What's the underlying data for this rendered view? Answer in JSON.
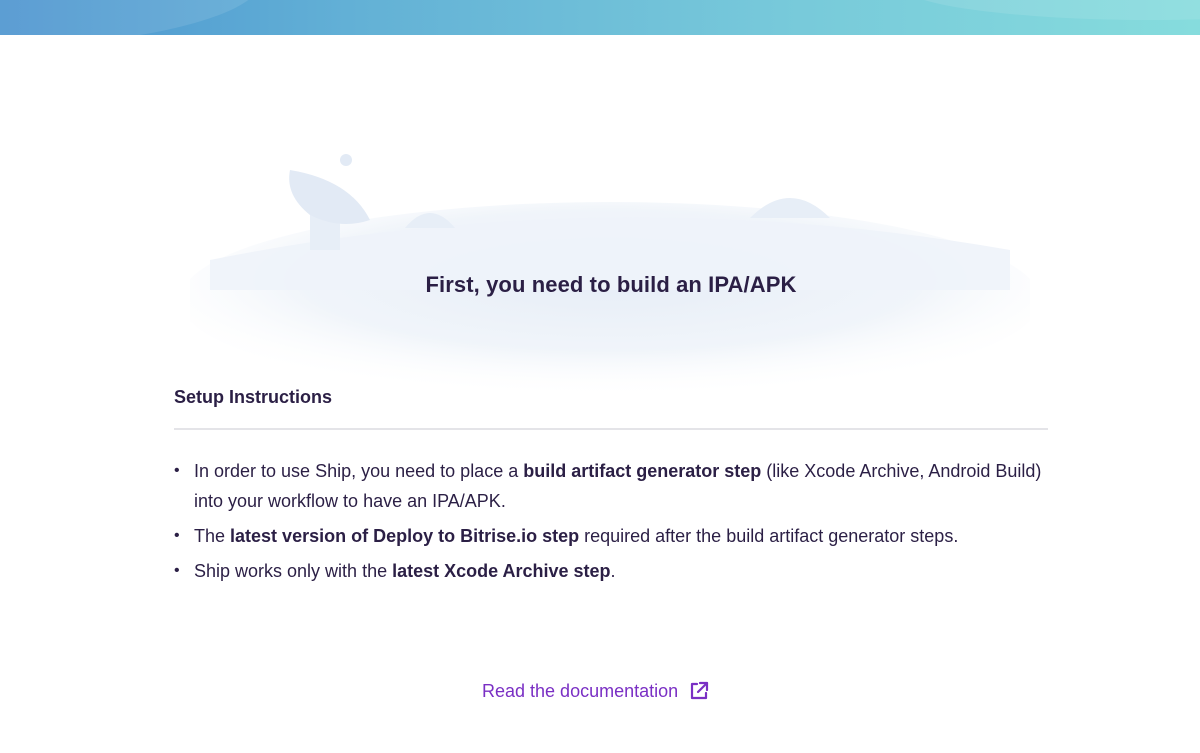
{
  "banner": {
    "colors": [
      "#4a93cf",
      "#86dcdd"
    ]
  },
  "empty_state": {
    "illustration": "radar-hill-illustration",
    "title": "First, you need to build an IPA/APK"
  },
  "setup": {
    "heading": "Setup Instructions",
    "items": [
      {
        "parts": [
          {
            "text": "In order to use Ship, you need to place a ",
            "bold": false
          },
          {
            "text": "build artifact generator step",
            "bold": true
          },
          {
            "text": " (like Xcode Archive, Android Build) into your workflow to have an IPA/APK.",
            "bold": false
          }
        ]
      },
      {
        "parts": [
          {
            "text": "The ",
            "bold": false
          },
          {
            "text": "latest version of Deploy to Bitrise.io step",
            "bold": true
          },
          {
            "text": " required after the build artifact generator steps.",
            "bold": false
          }
        ]
      },
      {
        "parts": [
          {
            "text": "Ship works only with the ",
            "bold": false
          },
          {
            "text": "latest Xcode Archive step",
            "bold": true
          },
          {
            "text": ".",
            "bold": false
          }
        ]
      }
    ]
  },
  "footer": {
    "doc_link_label": "Read the documentation",
    "doc_link_icon": "external-link-icon",
    "link_color": "#7a2fc4"
  }
}
